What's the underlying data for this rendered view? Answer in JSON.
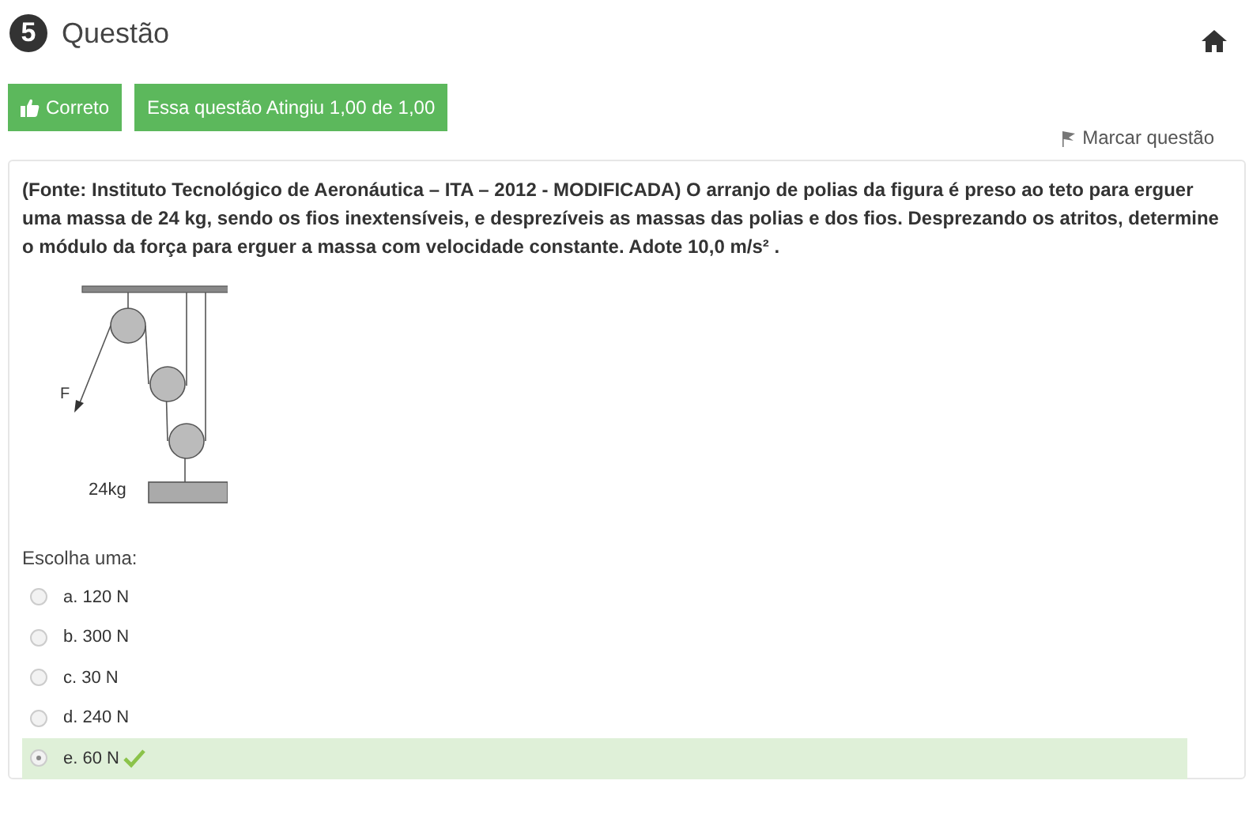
{
  "header": {
    "number": "5",
    "title": "Questão"
  },
  "badges": [
    {
      "kind": "status",
      "label": "Correto"
    },
    {
      "kind": "grade",
      "label": "Essa questão Atingiu 1,00 de 1,00"
    }
  ],
  "flag": {
    "label": "Marcar questão"
  },
  "question": {
    "text": "(Fonte: Instituto Tecnológico de Aeronáutica – ITA – 2012 - MODIFICADA) O arranjo de polias da figura é preso ao teto para erguer uma massa de 24 kg, sendo os fios inextensíveis, e desprezíveis as massas das polias e dos fios. Desprezando os atritos, determine o módulo da força para erguer a massa com velocidade constante. Adote 10,0 m/s² .",
    "figure": {
      "force_label": "F",
      "mass_label": "24kg"
    }
  },
  "prompt": "Escolha uma:",
  "options": [
    {
      "label": "a. 120 N",
      "selected": false,
      "correct": false
    },
    {
      "label": "b. 300 N",
      "selected": false,
      "correct": false
    },
    {
      "label": "c. 30 N",
      "selected": false,
      "correct": false
    },
    {
      "label": "d. 240 N",
      "selected": false,
      "correct": false
    },
    {
      "label": "e. 60 N",
      "selected": true,
      "correct": true
    }
  ]
}
